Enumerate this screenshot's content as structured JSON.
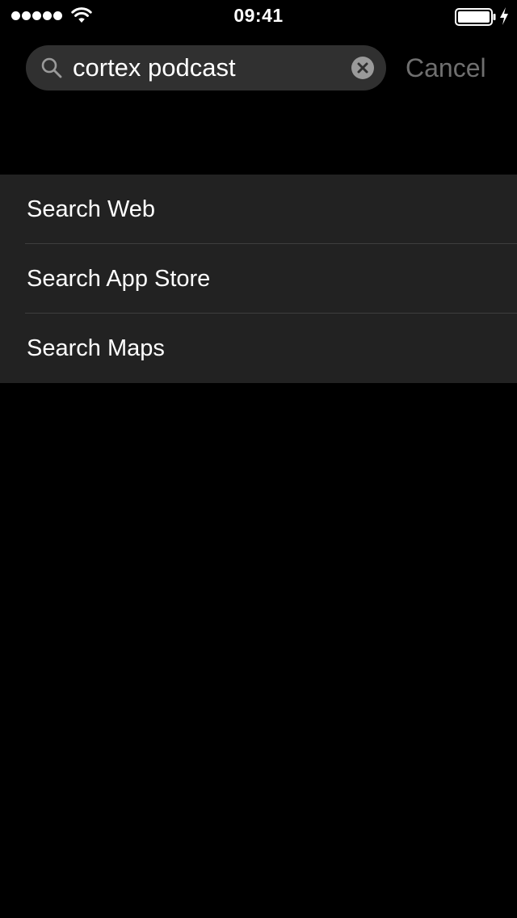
{
  "status_bar": {
    "time": "09:41",
    "signal_dots": 5
  },
  "search": {
    "query": "cortex podcast",
    "cancel_label": "Cancel"
  },
  "results": {
    "items": [
      {
        "label": "Search Web"
      },
      {
        "label": "Search App Store"
      },
      {
        "label": "Search Maps"
      }
    ]
  },
  "colors": {
    "background": "#000000",
    "search_field": "#303030",
    "list_background": "#222222",
    "separator": "#3e3e3e",
    "cancel_text": "#6f6f6f",
    "text": "#ffffff"
  }
}
